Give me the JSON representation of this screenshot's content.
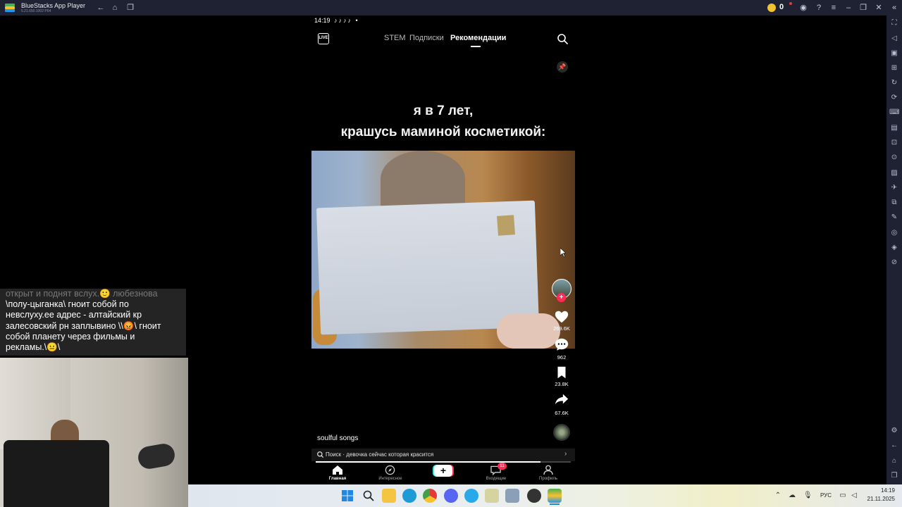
{
  "emulator": {
    "title": "BlueStacks App Player",
    "version": "5.21.650.1002 P64",
    "coins": "0"
  },
  "phone_status": {
    "time": "14:19",
    "icons": "♪♪♪♪ •"
  },
  "feed_tabs": [
    "STEM",
    "Подписки",
    "Рекомендации"
  ],
  "active_tab": "Рекомендации",
  "video": {
    "caption_line1": "я в 7 лет,",
    "caption_line2": "крашусь маминой косметикой:",
    "likes": "269.6K",
    "comments": "962",
    "bookmarks": "23.8K",
    "shares": "67.6K",
    "sound": "soulful songs",
    "progress": 0.88
  },
  "search_suggestion": "Поиск · девочка сейчас которая красится",
  "bottom_nav": {
    "home": "Главная",
    "discover": "Интересное",
    "inbox": "Входящие",
    "inbox_badge": "11",
    "profile": "Профиль"
  },
  "chat": {
    "line_faded": "открыт и поднят вслух.🙂 любезнова",
    "line1": "\\полу-цыганка\\ гноит собой по",
    "line2": "невслуху.ее адрес - алтайский кр",
    "line3": "залесовский рн заплывино \\\\😡\\ гноит",
    "line4": "собой планету через фильмы и",
    "line5": "рекламы.\\😐\\"
  },
  "taskbar": {
    "language": "РУС",
    "time": "14:19",
    "date": "21.11.2025"
  },
  "colors": {
    "tiktok_red": "#fe2c55",
    "tiktok_cyan": "#25f4ee",
    "titlebar": "#1f2233"
  }
}
